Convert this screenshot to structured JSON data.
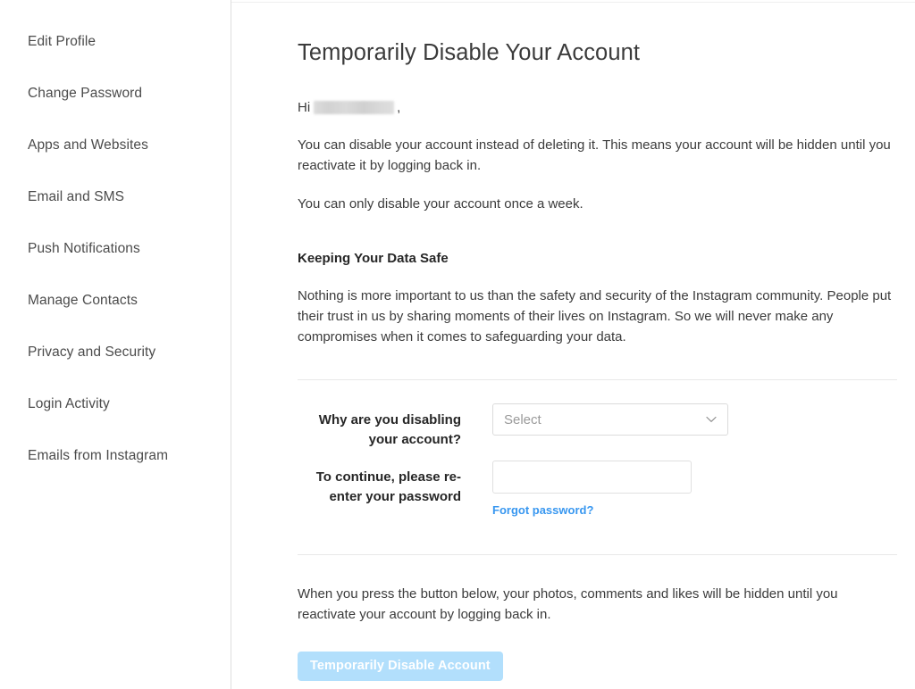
{
  "sidebar": {
    "items": [
      {
        "label": "Edit Profile",
        "name": "edit-profile"
      },
      {
        "label": "Change Password",
        "name": "change-password"
      },
      {
        "label": "Apps and Websites",
        "name": "apps-and-websites"
      },
      {
        "label": "Email and SMS",
        "name": "email-and-sms"
      },
      {
        "label": "Push Notifications",
        "name": "push-notifications"
      },
      {
        "label": "Manage Contacts",
        "name": "manage-contacts"
      },
      {
        "label": "Privacy and Security",
        "name": "privacy-and-security"
      },
      {
        "label": "Login Activity",
        "name": "login-activity"
      },
      {
        "label": "Emails from Instagram",
        "name": "emails-from-instagram"
      }
    ]
  },
  "main": {
    "title": "Temporarily Disable Your Account",
    "greeting_prefix": "Hi",
    "greeting_username": "",
    "greeting_suffix": ",",
    "paragraph_1": "You can disable your account instead of deleting it. This means your account will be hidden until you reactivate it by logging back in.",
    "paragraph_2": "You can only disable your account once a week.",
    "data_safe_heading": "Keeping Your Data Safe",
    "data_safe_body": "Nothing is more important to us than the safety and security of the Instagram community. People put their trust in us by sharing moments of their lives on Instagram. So we will never make any compromises when it comes to safeguarding your data."
  },
  "form": {
    "reason_label": "Why are you disabling your account?",
    "reason_value": "Select",
    "reason_placeholder": "Select",
    "password_label": "To continue, please re-enter your password",
    "password_value": "",
    "password_placeholder": "",
    "forgot_password_label": "Forgot password?",
    "chevron_icon": "chevron-down-icon"
  },
  "footer": {
    "notice": "When you press the button below, your photos, comments and likes will be hidden until you reactivate your account by logging back in.",
    "button_label": "Temporarily Disable Account"
  },
  "colors": {
    "link_blue": "#3897f0",
    "button_blue": "#b2dffc",
    "text_dark": "#262626",
    "text_body": "#3b3b3b",
    "border_light": "#dbdbdb"
  }
}
